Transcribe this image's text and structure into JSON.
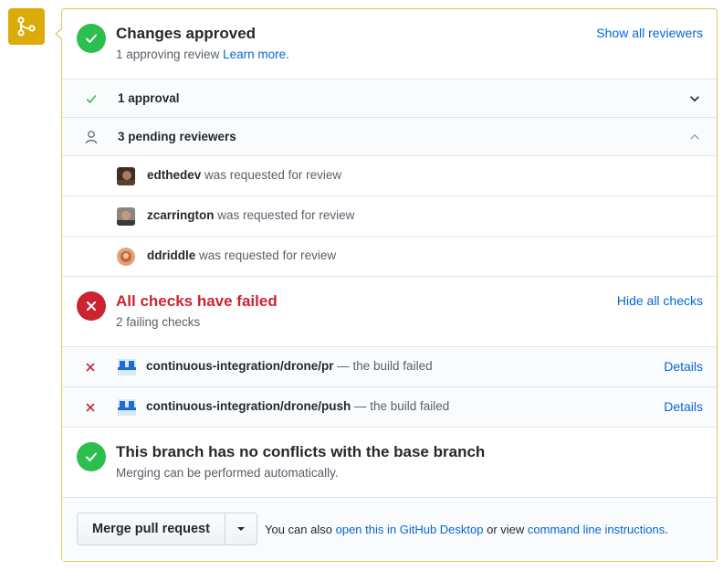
{
  "approval": {
    "title": "Changes approved",
    "subtitle": "1 approving review",
    "learn_more": "Learn more.",
    "show_all": "Show all reviewers"
  },
  "approvals_row": {
    "label": "1 approval"
  },
  "pending_row": {
    "label": "3 pending reviewers"
  },
  "reviewers": [
    {
      "name": "edthedev",
      "text": "was requested for review"
    },
    {
      "name": "zcarrington",
      "text": "was requested for review"
    },
    {
      "name": "ddriddle",
      "text": "was requested for review"
    }
  ],
  "checks": {
    "title": "All checks have failed",
    "subtitle": "2 failing checks",
    "hide_all": "Hide all checks",
    "items": [
      {
        "name": "continuous-integration/drone/pr",
        "status": "— the build failed",
        "details": "Details"
      },
      {
        "name": "continuous-integration/drone/push",
        "status": "— the build failed",
        "details": "Details"
      }
    ]
  },
  "conflicts": {
    "title": "This branch has no conflicts with the base branch",
    "subtitle": "Merging can be performed automatically."
  },
  "merge": {
    "button": "Merge pull request",
    "text_before": "You can also",
    "desktop_link": "open this in GitHub Desktop",
    "text_middle": "or view",
    "cli_link": "command line instructions",
    "text_after": "."
  },
  "colors": {
    "merge_badge": "#dbab09",
    "success": "#2cbe4e",
    "failure": "#cb2431",
    "link": "#0366d6"
  }
}
